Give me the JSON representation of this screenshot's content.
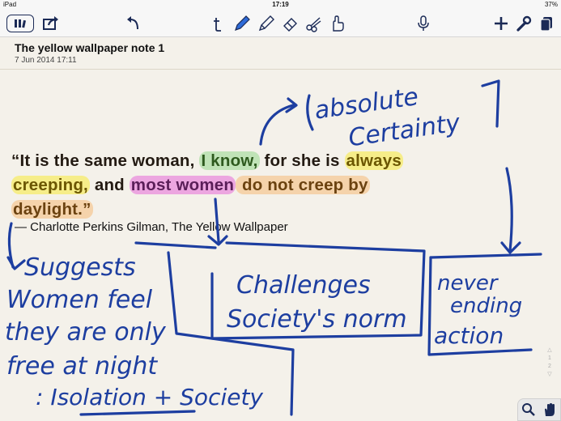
{
  "status_bar": {
    "device": "iPad",
    "time": "17:19",
    "battery": "37%"
  },
  "toolbar": {
    "items": [
      "library",
      "share",
      "undo",
      "text-tool",
      "pen-tool",
      "highlighter-tool",
      "eraser-tool",
      "scissors-tool",
      "hand-tool",
      "microphone",
      "add",
      "settings",
      "pages"
    ]
  },
  "note": {
    "title": "The yellow wallpaper note 1",
    "date": "7 Jun 2014 17:11"
  },
  "quote": {
    "p1": "“It is the same woman, ",
    "h_know": "I know,",
    "p2": " for she is ",
    "h_always": "always",
    "h_creeping": "creeping,",
    "p3": " and ",
    "h_most": "most women",
    "h_donot": " do not creep by",
    "h_daylight": "daylight.”",
    "attribution": "— Charlotte Perkins Gilman, The Yellow Wallpaper"
  },
  "handwriting": {
    "absolute": "absolute",
    "certainty": "Certainty",
    "suggests_1": "Suggests",
    "suggests_2": "Women feel",
    "suggests_3": "they are only",
    "suggests_4": "free at night",
    "suggests_5": ": Isolation + Society",
    "challenges_1": "Challenges",
    "challenges_2": "Society's norm",
    "never_1": "never",
    "never_2": "ending",
    "never_3": "action"
  },
  "pager": {
    "page_1": "1",
    "page_2": "2"
  },
  "colors": {
    "ink": "#1d3ea0",
    "toolbar_icon": "#1b2a56",
    "paper": "#f4f1ea"
  }
}
